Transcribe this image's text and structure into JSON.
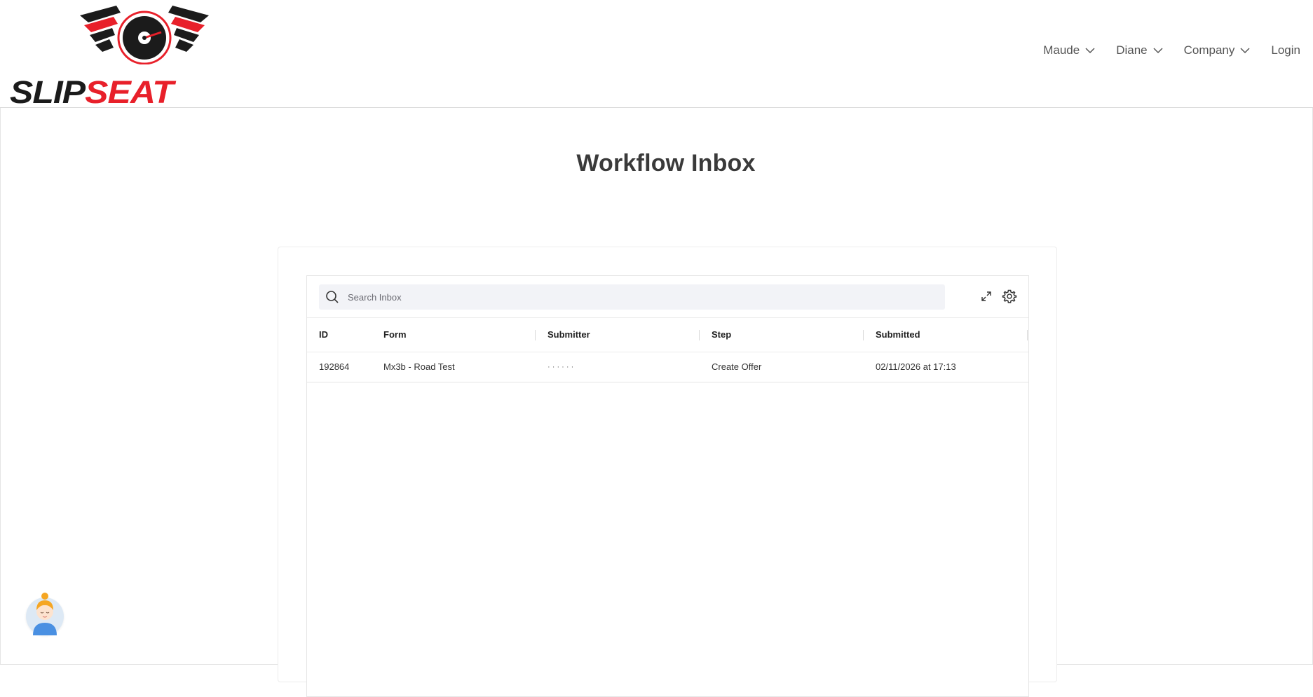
{
  "brand": {
    "word_part1": "SLIP",
    "word_part2": "SEAT",
    "accent": "#e8202a",
    "dark": "#1b1b1b"
  },
  "nav": {
    "items": [
      {
        "label": "Maude",
        "dropdown": true
      },
      {
        "label": "Diane",
        "dropdown": true
      },
      {
        "label": "Company",
        "dropdown": true
      },
      {
        "label": "Login",
        "dropdown": false
      }
    ]
  },
  "page": {
    "title": "Workflow Inbox"
  },
  "inbox": {
    "search_placeholder": "Search Inbox",
    "icons": [
      "search-icon",
      "expand-icon",
      "gear-icon"
    ],
    "columns": [
      "ID",
      "Form",
      "Submitter",
      "Step",
      "Submitted"
    ],
    "rows": [
      {
        "id": "192864",
        "form": "Mx3b - Road Test",
        "submitter": "· · · · ·  ·",
        "step": "Create Offer",
        "submitted": "02/11/2026 at 17:13"
      }
    ]
  }
}
